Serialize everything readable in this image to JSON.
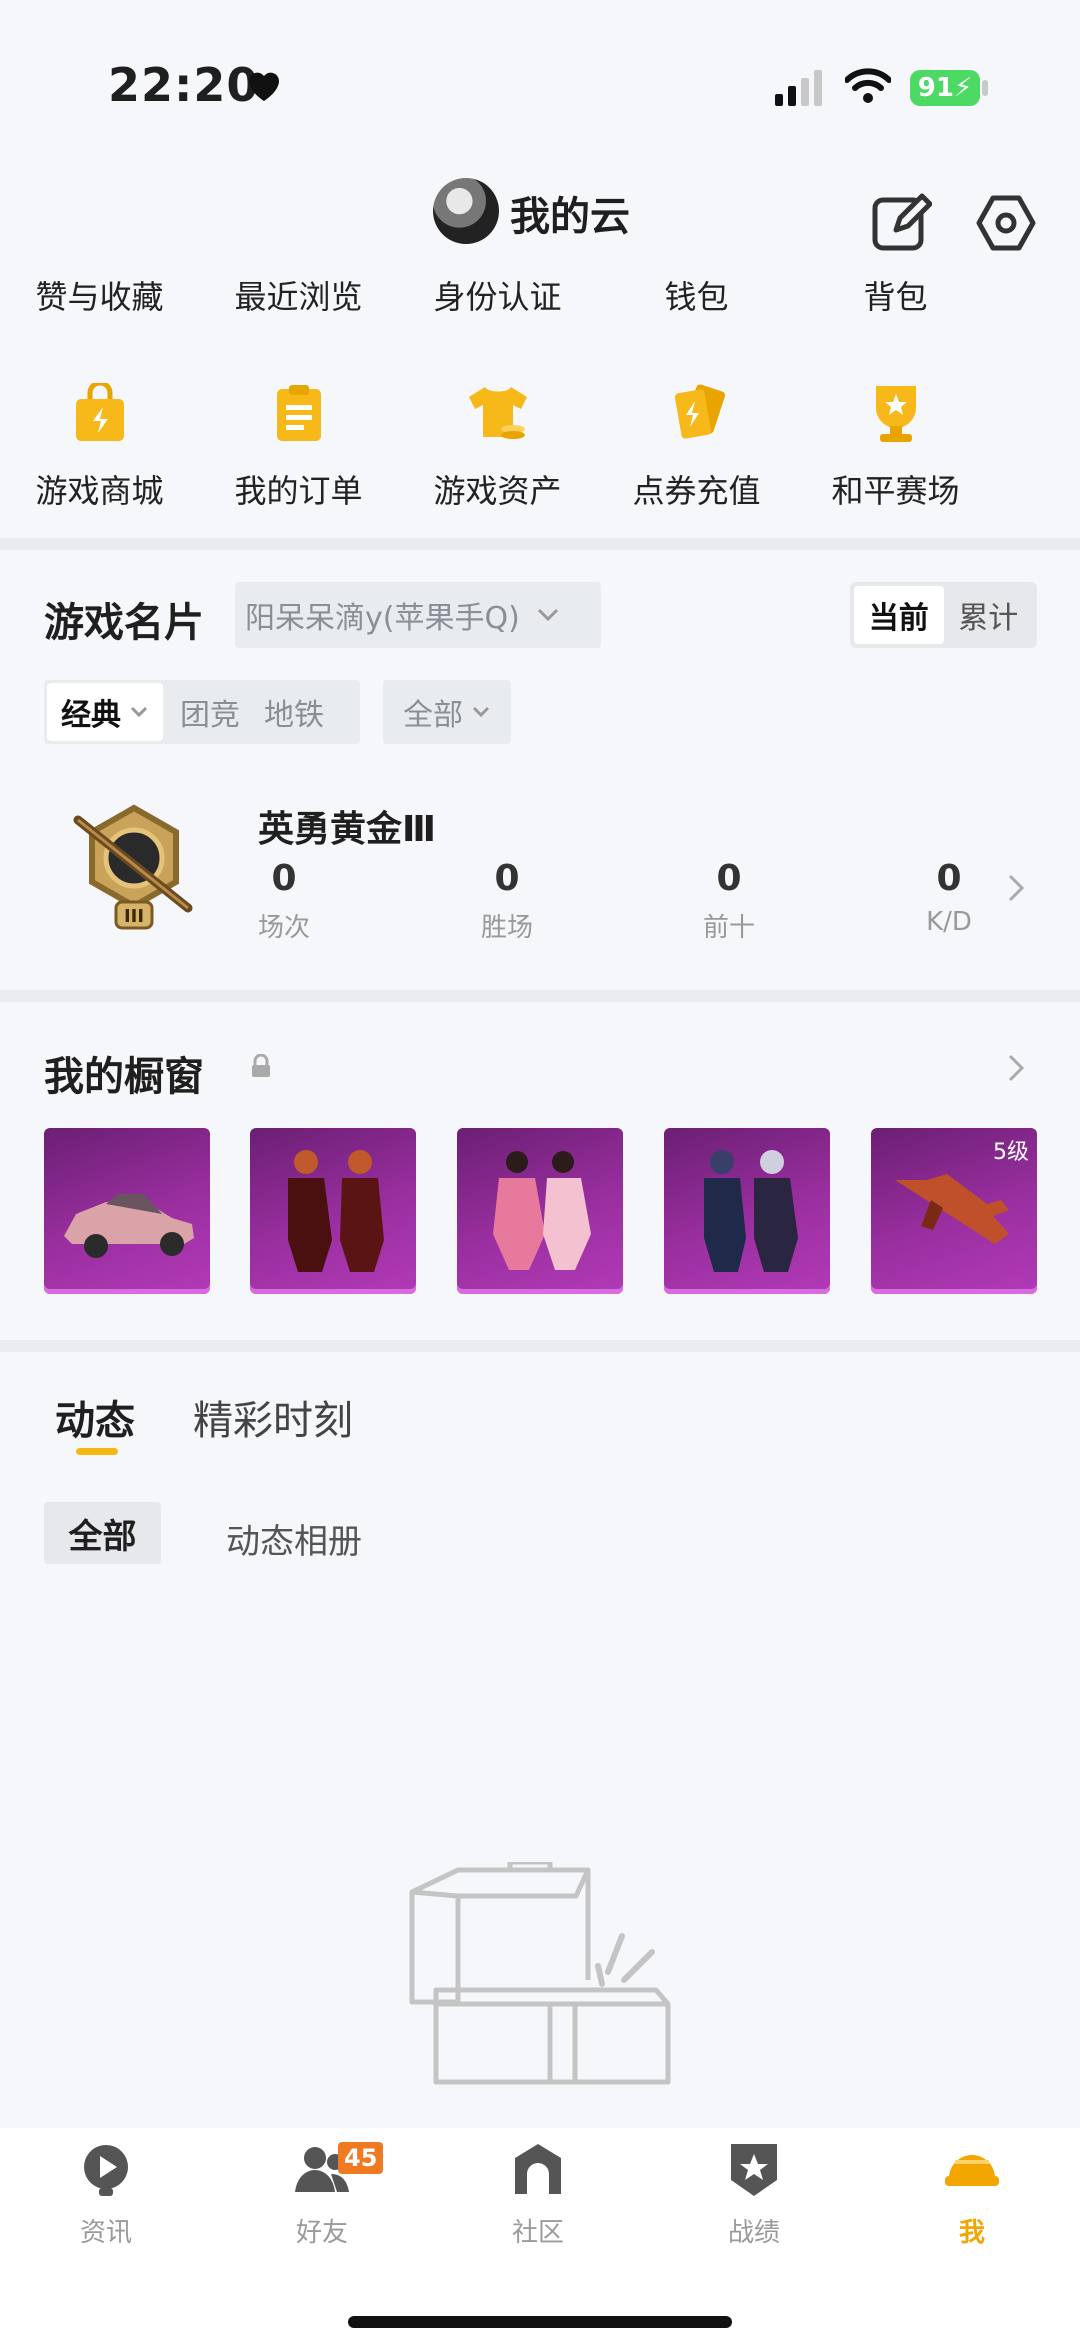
{
  "status_bar": {
    "time": "22:20",
    "battery": "91"
  },
  "profile": {
    "name": "我的云"
  },
  "quick_links": [
    "赞与收藏",
    "最近浏览",
    "身份认证",
    "钱包",
    "背包"
  ],
  "services": [
    {
      "label": "游戏商城",
      "icon": "shopping-bag-icon"
    },
    {
      "label": "我的订单",
      "icon": "clipboard-icon"
    },
    {
      "label": "游戏资产",
      "icon": "tshirt-icon"
    },
    {
      "label": "点券充值",
      "icon": "coupon-cards-icon"
    },
    {
      "label": "和平赛场",
      "icon": "trophy-icon"
    }
  ],
  "game_card": {
    "title": "游戏名片",
    "account": "阳呆呆滴y(苹果手Q)",
    "toggle": [
      "当前",
      "累计"
    ],
    "modes": [
      "经典",
      "团竞",
      "地铁"
    ],
    "filter": "全部",
    "rank": "英勇黄金Ⅲ",
    "stats": [
      {
        "value": "0",
        "label": "场次"
      },
      {
        "value": "0",
        "label": "胜场"
      },
      {
        "value": "0",
        "label": "前十"
      },
      {
        "value": "0",
        "label": "K/D"
      }
    ]
  },
  "showcase": {
    "title": "我的橱窗",
    "items": [
      {
        "icon": "car-icon"
      },
      {
        "icon": "outfit-icon"
      },
      {
        "icon": "outfit-icon"
      },
      {
        "icon": "outfit-icon"
      },
      {
        "icon": "rifle-icon",
        "level": "5级"
      }
    ]
  },
  "feed": {
    "tabs": [
      "动态",
      "精彩时刻"
    ],
    "chips": [
      "全部",
      "动态相册"
    ]
  },
  "nav": [
    {
      "label": "资讯"
    },
    {
      "label": "好友",
      "badge": "45"
    },
    {
      "label": "社区"
    },
    {
      "label": "战绩"
    },
    {
      "label": "我",
      "active": true
    }
  ],
  "colors": {
    "accent": "#f3b814",
    "badge": "#f07a22",
    "showcase": "#9a2fa0"
  }
}
